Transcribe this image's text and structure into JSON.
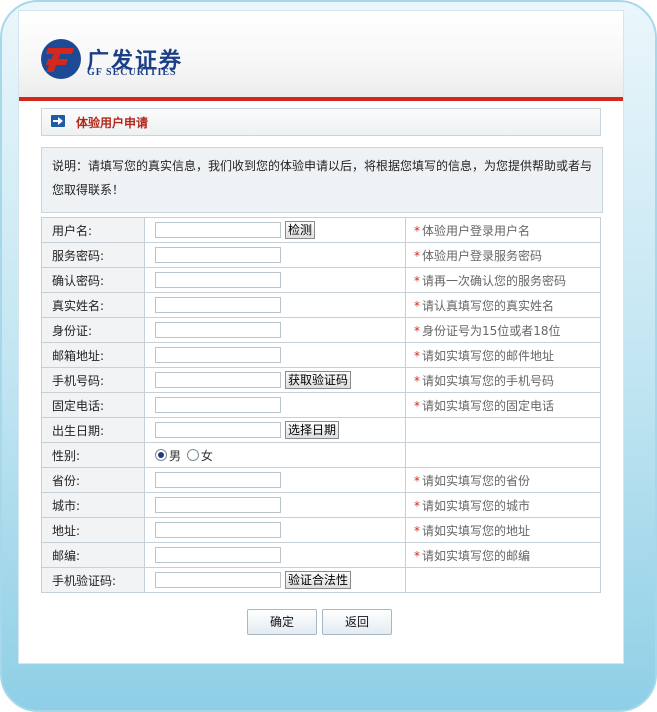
{
  "header": {
    "brand_cn": "广发证券",
    "brand_en": "GF SECURITIES",
    "logo_icon": "gf-securities-logo-icon"
  },
  "section": {
    "title": "体验用户申请",
    "icon": "arrow-right-icon"
  },
  "description": "说明：请填写您的真实信息，我们收到您的体验申请以后，将根据您填写的信息，为您提供帮助或者与您取得联系！",
  "form": {
    "rows": [
      {
        "label": "用户名:",
        "button": "检测",
        "hint": "体验用户登录用户名"
      },
      {
        "label": "服务密码:",
        "hint": "体验用户登录服务密码"
      },
      {
        "label": "确认密码:",
        "hint": "请再一次确认您的服务密码"
      },
      {
        "label": "真实姓名:",
        "hint": "请认真填写您的真实姓名"
      },
      {
        "label": "身份证:",
        "hint": "身份证号为15位或者18位"
      },
      {
        "label": "邮箱地址:",
        "hint": "请如实填写您的邮件地址"
      },
      {
        "label": "手机号码:",
        "button": "获取验证码",
        "hint": "请如实填写您的手机号码"
      },
      {
        "label": "固定电话:",
        "hint": "请如实填写您的固定电话"
      },
      {
        "label": "出生日期:",
        "button": "选择日期",
        "hint": ""
      },
      {
        "label": "性别:",
        "hint": ""
      },
      {
        "label": "省份:",
        "hint": "请如实填写您的省份"
      },
      {
        "label": "城市:",
        "hint": "请如实填写您的城市"
      },
      {
        "label": "地址:",
        "hint": "请如实填写您的地址"
      },
      {
        "label": "邮编:",
        "hint": "请如实填写您的邮编"
      },
      {
        "label": "手机验证码:",
        "button": "验证合法性",
        "hint": ""
      }
    ],
    "gender": {
      "male": "男",
      "female": "女",
      "selected": "男"
    },
    "required_mark": "*"
  },
  "actions": {
    "ok": "确定",
    "back": "返回"
  },
  "colors": {
    "brand_blue": "#1b3f86",
    "brand_red": "#d4281c",
    "title_red": "#b4281c"
  }
}
